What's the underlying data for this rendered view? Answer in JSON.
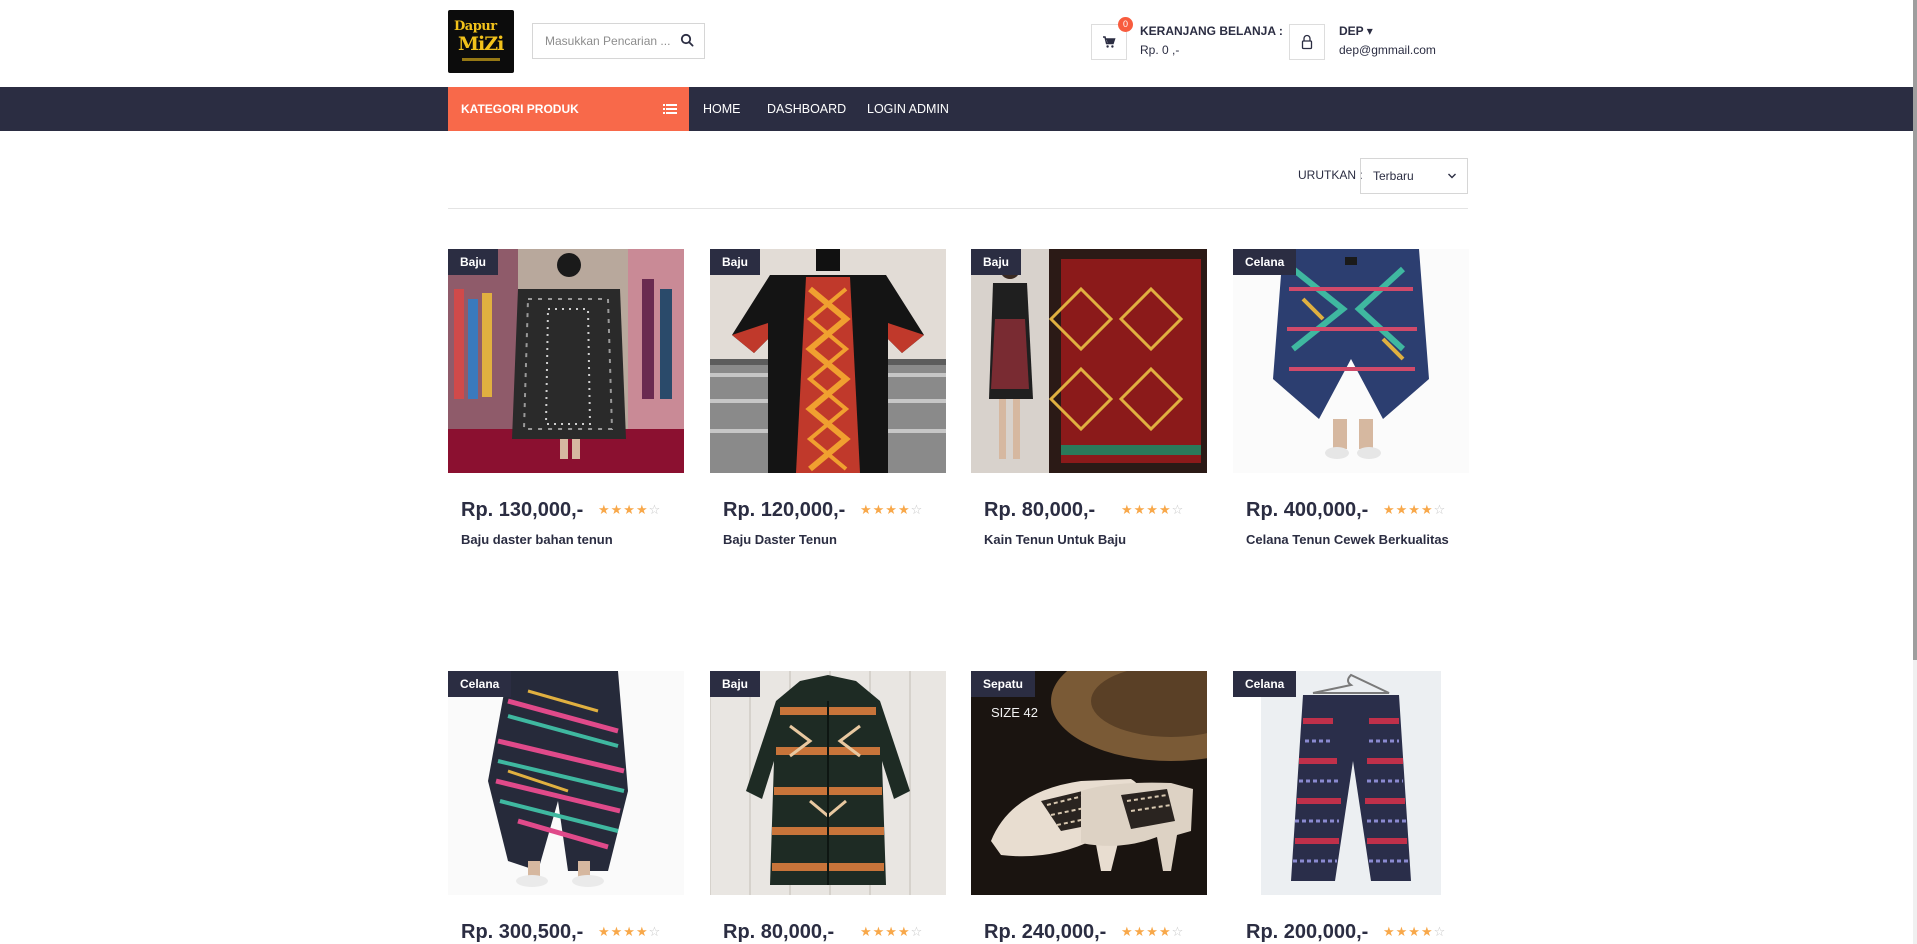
{
  "brand": {
    "logo_line1": "Dapur",
    "logo_line2": "MiZi"
  },
  "search": {
    "placeholder": "Masukkan Pencarian ..."
  },
  "cart": {
    "count": "0",
    "title": "KERANJANG BELANJA :",
    "total": "Rp. 0 ,-"
  },
  "user": {
    "name": "DEP ▾",
    "email": "dep@gmmail.com"
  },
  "nav": {
    "category_label": "KATEGORI PRODUK",
    "items": [
      "HOME",
      "DASHBOARD",
      "LOGIN ADMIN"
    ]
  },
  "sort": {
    "label": "URUTKAN :",
    "selected": "Terbaru"
  },
  "rating_stars": 4,
  "products": [
    {
      "category": "Baju",
      "price": "Rp. 130,000,-",
      "name": "Baju daster bahan tenun"
    },
    {
      "category": "Baju",
      "price": "Rp. 120,000,-",
      "name": "Baju Daster Tenun"
    },
    {
      "category": "Baju",
      "price": "Rp. 80,000,-",
      "name": "Kain Tenun Untuk Baju"
    },
    {
      "category": "Celana",
      "price": "Rp. 400,000,-",
      "name": "Celana Tenun Cewek Berkualitas"
    },
    {
      "category": "Celana",
      "price": "Rp. 300,500,-",
      "name": ""
    },
    {
      "category": "Baju",
      "price": "Rp. 80,000,-",
      "name": ""
    },
    {
      "category": "Sepatu",
      "price": "Rp. 240,000,-",
      "name": "",
      "image_text": "SIZE 42"
    },
    {
      "category": "Celana",
      "price": "Rp. 200,000,-",
      "name": ""
    }
  ],
  "colors": {
    "dark": "#2b2d42",
    "accent": "#f8694a",
    "star": "#f8a84a"
  }
}
